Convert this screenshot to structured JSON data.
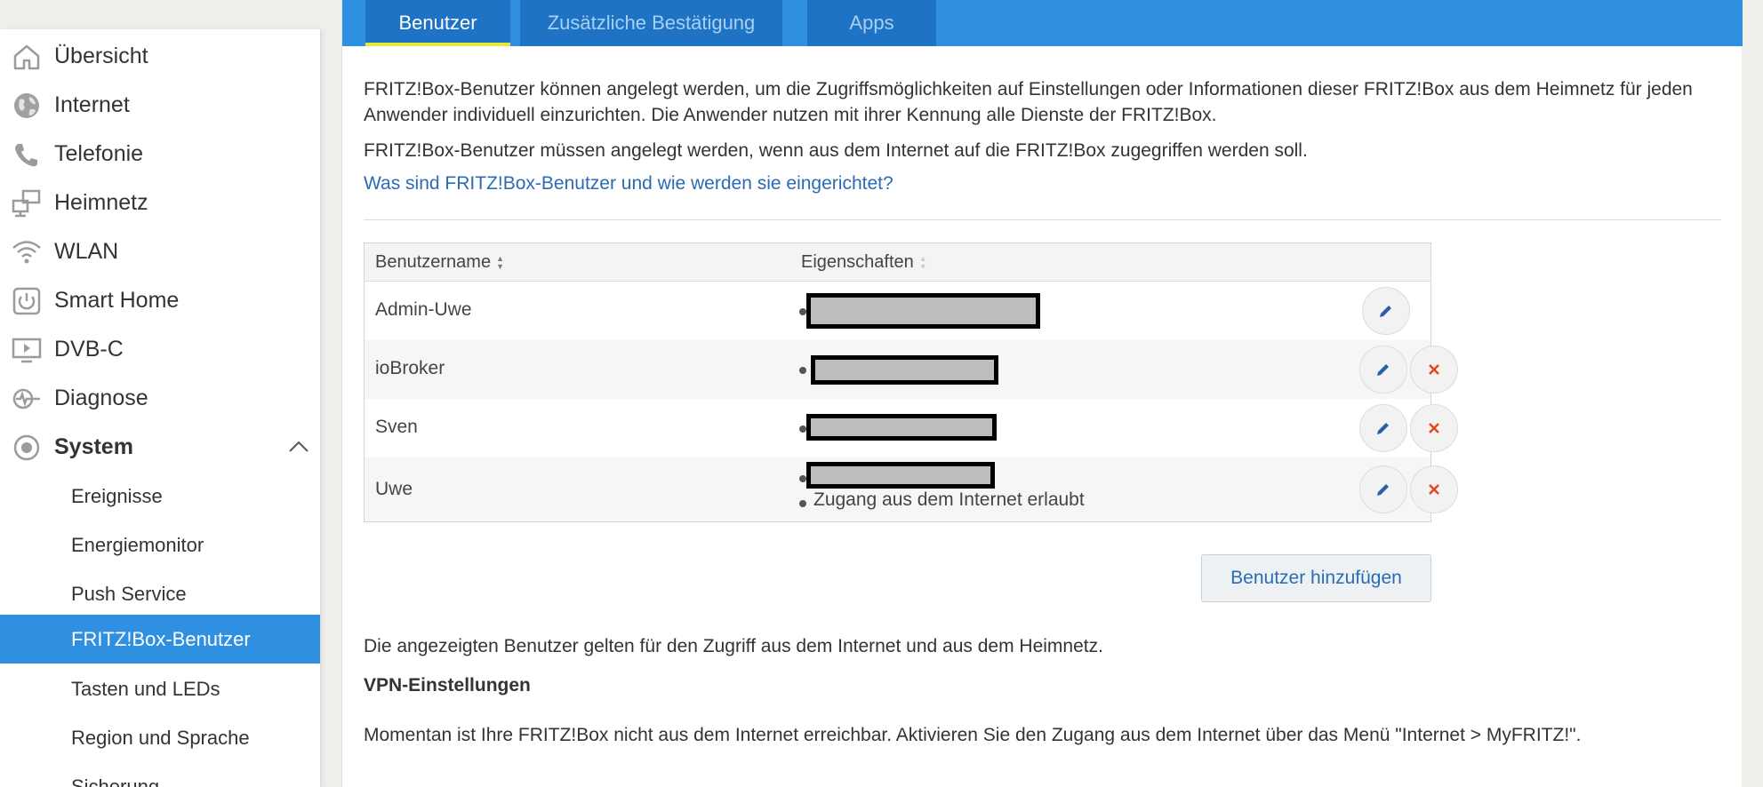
{
  "sidebar": {
    "items": [
      {
        "label": "Übersicht",
        "icon": "home-icon"
      },
      {
        "label": "Internet",
        "icon": "globe-icon"
      },
      {
        "label": "Telefonie",
        "icon": "phone-icon"
      },
      {
        "label": "Heimnetz",
        "icon": "network-icon"
      },
      {
        "label": "WLAN",
        "icon": "wifi-icon"
      },
      {
        "label": "Smart Home",
        "icon": "power-icon"
      },
      {
        "label": "DVB-C",
        "icon": "tv-icon"
      },
      {
        "label": "Diagnose",
        "icon": "diagnose-icon"
      },
      {
        "label": "System",
        "icon": "system-icon",
        "expanded": true
      }
    ],
    "subitems": [
      {
        "label": "Ereignisse"
      },
      {
        "label": "Energiemonitor"
      },
      {
        "label": "Push Service"
      },
      {
        "label": "FRITZ!Box-Benutzer",
        "active": true
      },
      {
        "label": "Tasten und LEDs"
      },
      {
        "label": "Region und Sprache"
      },
      {
        "label": "Sicherung"
      }
    ]
  },
  "tabs": [
    {
      "label": "Benutzer",
      "active": true
    },
    {
      "label": "Zusätzliche Bestätigung",
      "active": false
    },
    {
      "label": "Apps",
      "active": false
    }
  ],
  "intro": {
    "p1": "FRITZ!Box-Benutzer können angelegt werden, um die Zugriffsmöglichkeiten auf Einstellungen oder Informationen dieser FRITZ!Box aus dem Heimnetz für jeden Anwender individuell einzurichten. Die Anwender nutzen mit ihrer Kennung alle Dienste der FRITZ!Box.",
    "p2": "FRITZ!Box-Benutzer müssen angelegt werden, wenn aus dem Internet auf die FRITZ!Box zugegriffen werden soll.",
    "help_link": "Was sind FRITZ!Box-Benutzer und wie werden sie eingerichtet?"
  },
  "table": {
    "col_name": "Benutzername",
    "col_props": "Eigenschaften",
    "rows": [
      {
        "name": "Admin-Uwe",
        "extra": ""
      },
      {
        "name": "ioBroker",
        "extra": ""
      },
      {
        "name": "Sven",
        "extra": ""
      },
      {
        "name": "Uwe",
        "extra": "Zugang aus dem Internet erlaubt"
      }
    ]
  },
  "add_button": "Benutzer hinzufügen",
  "note": "Die angezeigten Benutzer gelten für den Zugriff aus dem Internet und aus dem Heimnetz.",
  "vpn": {
    "heading": "VPN-Einstellungen",
    "text": "Momentan ist Ihre FRITZ!Box nicht aus dem Internet erreichbar. Aktivieren Sie den Zugang aus dem Internet über das Menü \"Internet > MyFRITZ!\"."
  },
  "colors": {
    "accent": "#2f8fe0",
    "tab": "#1e73c4",
    "tab_indicator": "#e6e83c",
    "link": "#2b6bb5",
    "delete": "#e2461f"
  }
}
